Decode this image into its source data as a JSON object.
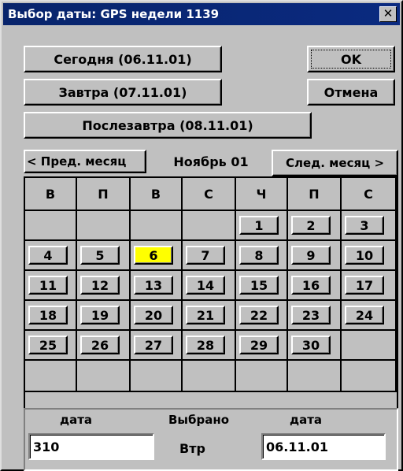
{
  "window": {
    "title": "Выбор даты: GPS недели 1139",
    "close_glyph": "✕"
  },
  "buttons": {
    "today": "Сегодня (06.11.01)",
    "tomorrow": "Завтра (07.11.01)",
    "day_after": "Послезавтра (08.11.01)",
    "ok": "OK",
    "cancel": "Отмена",
    "prev_month": "< Пред. месяц",
    "next_month": "След. месяц >"
  },
  "month_label": "Ноябрь 01",
  "weekdays": [
    "В",
    "П",
    "В",
    "С",
    "Ч",
    "П",
    "С"
  ],
  "weeks": [
    [
      "",
      "",
      "",
      "",
      "1",
      "2",
      "3"
    ],
    [
      "4",
      "5",
      "6",
      "7",
      "8",
      "9",
      "10"
    ],
    [
      "11",
      "12",
      "13",
      "14",
      "15",
      "16",
      "17"
    ],
    [
      "18",
      "19",
      "20",
      "21",
      "22",
      "23",
      "24"
    ],
    [
      "25",
      "26",
      "27",
      "28",
      "29",
      "30",
      ""
    ],
    [
      "",
      "",
      "",
      "",
      "",
      "",
      ""
    ]
  ],
  "selected_day": "6",
  "selected_color": "#ffff00",
  "bottom": {
    "label_left": "дата",
    "label_center": "Выбрано",
    "label_right": "дата",
    "value_left": "310",
    "value_center": "Втр",
    "value_right": "06.11.01"
  }
}
